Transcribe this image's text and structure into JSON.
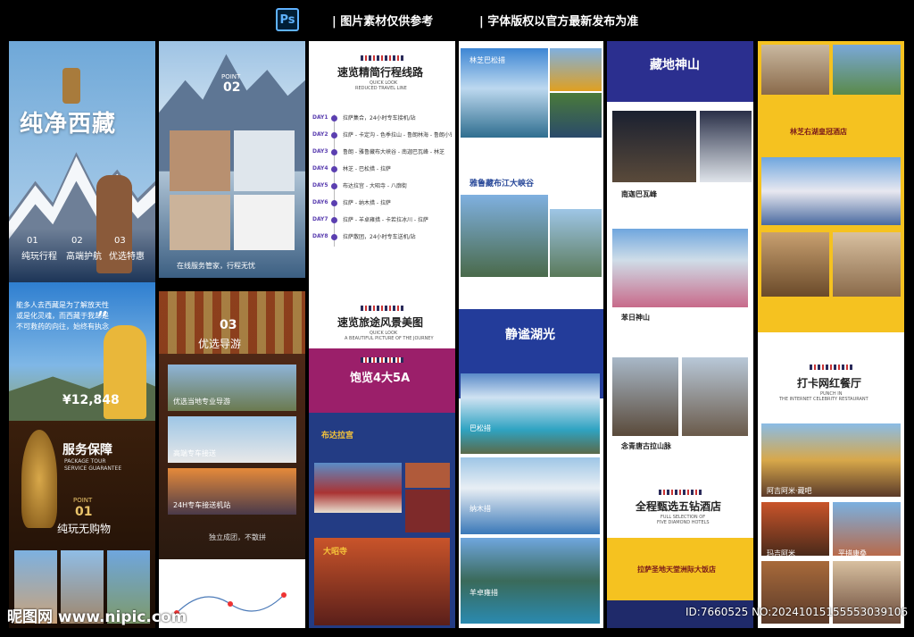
{
  "header": {
    "top_left": "图片素材仅供参考",
    "top_right": "字体版权以官方最新发布为准",
    "ps_icon": "Ps"
  },
  "col1": {
    "title": "纯净西藏",
    "features": [
      "纯玩行程",
      "高端护航",
      "优选特惠"
    ],
    "nums": [
      "01",
      "02",
      "03"
    ],
    "quote_lines": [
      "能多人去西藏是为了解放天性",
      "或是化灵魂，而西藏于我却是",
      "不可救药的向往，始终有执念"
    ],
    "price": "¥12,848",
    "service_title": "服务保障",
    "service_en1": "PACKAGE TOUR",
    "service_en2": "SERVICE GUARANTEE",
    "point": "POINT",
    "point_num": "01",
    "point_text": "纯玩无购物"
  },
  "col2": {
    "point": "POINT",
    "num1": "02",
    "cap1": "在线服务管家，行程无忧",
    "num2": "03",
    "title2": "优选导游",
    "cap_a": "优选当地专业导游",
    "cap_b": "高端专车接送",
    "cap_c": "24H专车接送机站",
    "foot": "独立成团，不散拼"
  },
  "col3": {
    "title1": "速览精简行程线路",
    "en1a": "QUICK LOOK",
    "en1b": "REDUCED TRAVEL LINE",
    "days": [
      "DAY1",
      "DAY2",
      "DAY3",
      "DAY4",
      "DAY5",
      "DAY6",
      "DAY7",
      "DAY8"
    ],
    "items": [
      "拉萨集合，24小时专车接机/站",
      "拉萨 - 卡定沟 - 色季拉山 - 鲁朗林海 - 鲁朗小镇",
      "鲁朗 - 雅鲁藏布大峡谷 - 南迦巴瓦峰 - 林芝",
      "林芝 - 巴松措 - 拉萨",
      "布达拉宫 - 大昭寺 - 八廓街",
      "拉萨 - 纳木措 - 拉萨",
      "拉萨 - 羊卓雍措 - 卡若拉冰川 - 拉萨",
      "拉萨散团，24小时专车送机/站"
    ],
    "title2": "速览旅途风景美图",
    "en2a": "QUICK LOOK",
    "en2b": "A BEAUTIFUL PICTURE OF THE JOURNEY",
    "banner": "饱览4大5A",
    "potala": "布达拉宫",
    "jokhang": "大昭寺"
  },
  "col4": {
    "l1": "林芝巴松措",
    "l2": "雅鲁藏布江大峡谷",
    "title": "静谧湖光",
    "l3": "巴松措",
    "l4": "纳木措",
    "l5": "羊卓雍措"
  },
  "col5": {
    "title": "藏地神山",
    "p1": "南迦巴瓦峰",
    "p2": "苯日神山",
    "p3": "念青唐古拉山脉",
    "hotel_title": "全程甄选五钻酒店",
    "hotel_en1": "FULL SELECTION OF",
    "hotel_en2": "FIVE DIAMOND HOTELS",
    "hotel_name": "拉萨圣地天堂洲际大饭店"
  },
  "col6": {
    "hotel_name": "林芝右湖皇冠酒店",
    "title": "打卡网红餐厅",
    "en1": "PUNCH IN",
    "en2": "THE INTERNET CELEBRITY RESTAURANT",
    "r1": "阿吉阿米·藏吧",
    "r2": "玛吉阿米",
    "r3": "平措康桑"
  },
  "footer": {
    "watermark": "昵图网 www.nipic.com",
    "id": "ID:7660525 NO:20241015155553039106"
  }
}
